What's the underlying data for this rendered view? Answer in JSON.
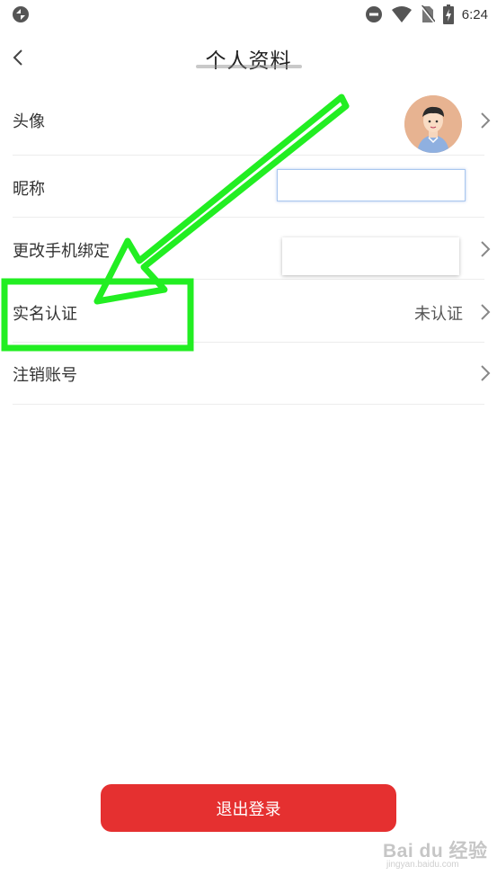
{
  "status_bar": {
    "time": "6:24",
    "icons": [
      "app-logo-icon",
      "do-not-disturb-icon",
      "wifi-icon",
      "no-sim-icon",
      "battery-charging-icon"
    ]
  },
  "header": {
    "title": "个人资料",
    "back_icon": "chevron-left-icon"
  },
  "rows": [
    {
      "label": "头像",
      "kind": "avatar"
    },
    {
      "label": "昵称",
      "kind": "input",
      "value": "",
      "placeholder": ""
    },
    {
      "label": "更改手机绑定",
      "kind": "hidden-value"
    },
    {
      "label": "实名认证",
      "value": "未认证"
    },
    {
      "label": "注销账号"
    }
  ],
  "logout": {
    "label": "退出登录"
  },
  "annotation": {
    "color": "#22ee22"
  },
  "watermark": {
    "text": "Bai du 经验",
    "sub": "jingyan.baidu.com"
  },
  "colors": {
    "accent": "#e53030",
    "divider": "#ececec",
    "text": "#333333"
  }
}
